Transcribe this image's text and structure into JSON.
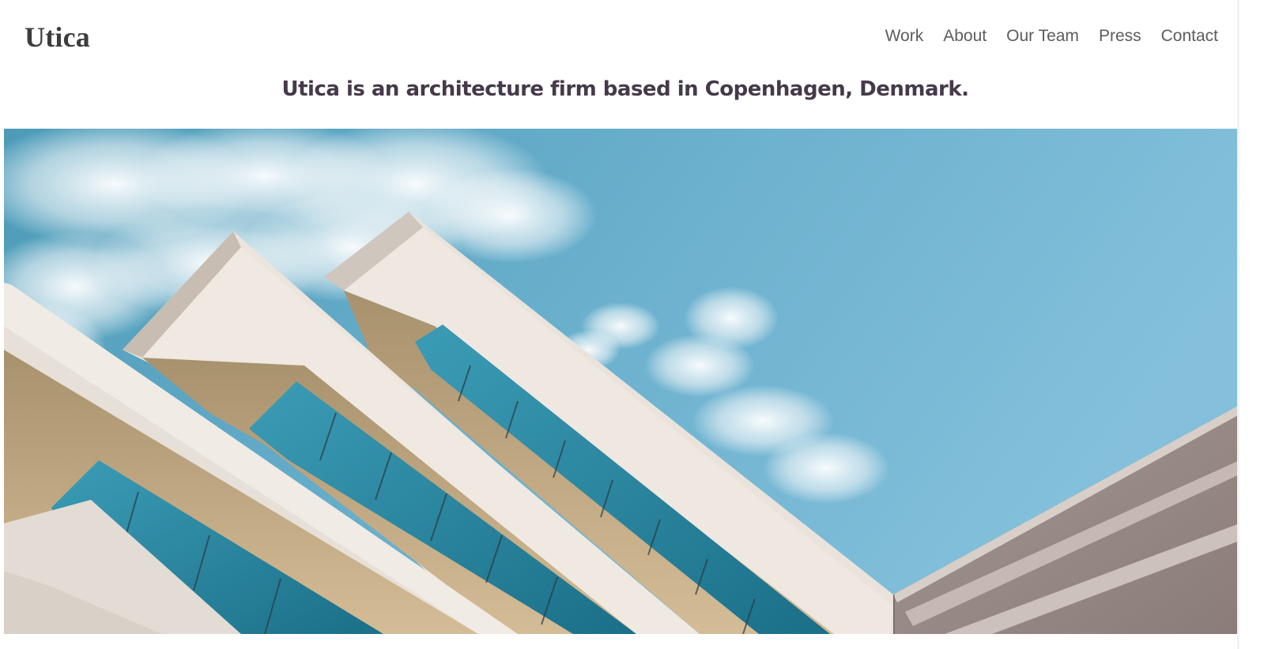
{
  "brand": {
    "name": "Utica"
  },
  "nav": {
    "items": [
      {
        "label": "Work"
      },
      {
        "label": "About"
      },
      {
        "label": "Our Team"
      },
      {
        "label": "Press"
      },
      {
        "label": "Contact"
      }
    ]
  },
  "hero": {
    "tagline": "Utica is an architecture firm based in Copenhagen, Denmark."
  },
  "colors": {
    "sky": "#6bb2cf",
    "text_dark": "#45394a",
    "nav_text": "#5c5c5c",
    "facade_light": "#e9e2da",
    "facade_tan": "#cdb591",
    "glass": "#2b86a0"
  }
}
